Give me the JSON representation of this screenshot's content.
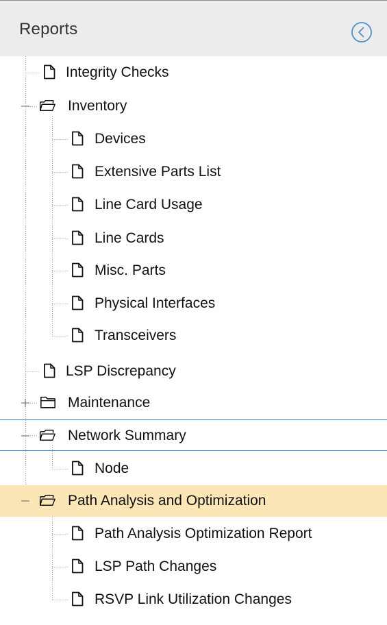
{
  "header": {
    "title": "Reports",
    "collapse_icon": "chevron-left-circle-icon"
  },
  "colors": {
    "header_bg": "#ececec",
    "selected_bg": "#fbe7b5",
    "focus_border": "#4a8fcf",
    "collapse_icon": "#4a8fcf"
  },
  "tree": {
    "nodes": [
      {
        "label": "Integrity Checks",
        "type": "report",
        "icon": "document-icon"
      },
      {
        "label": "Inventory",
        "type": "folder",
        "expanded": true,
        "icon": "open-folder-icon",
        "toggle": "minus"
      },
      {
        "label": "Devices",
        "type": "report",
        "icon": "document-icon"
      },
      {
        "label": "Extensive Parts List",
        "type": "report",
        "icon": "document-icon"
      },
      {
        "label": "Line Card Usage",
        "type": "report",
        "icon": "document-icon"
      },
      {
        "label": "Line Cards",
        "type": "report",
        "icon": "document-icon"
      },
      {
        "label": "Misc. Parts",
        "type": "report",
        "icon": "document-icon"
      },
      {
        "label": "Physical Interfaces",
        "type": "report",
        "icon": "document-icon"
      },
      {
        "label": "Transceivers",
        "type": "report",
        "icon": "document-icon"
      },
      {
        "label": "LSP Discrepancy",
        "type": "report",
        "icon": "document-icon"
      },
      {
        "label": "Maintenance",
        "type": "folder",
        "expanded": false,
        "icon": "closed-folder-icon",
        "toggle": "plus"
      },
      {
        "label": "Network Summary",
        "type": "folder",
        "expanded": true,
        "icon": "open-folder-icon",
        "toggle": "minus",
        "focused": true
      },
      {
        "label": "Node",
        "type": "report",
        "icon": "document-icon"
      },
      {
        "label": "Path Analysis and Optimization",
        "type": "folder",
        "expanded": true,
        "icon": "open-folder-icon",
        "toggle": "minus",
        "selected": true
      },
      {
        "label": "Path Analysis Optimization Report",
        "type": "report",
        "icon": "document-icon"
      },
      {
        "label": "LSP Path Changes",
        "type": "report",
        "icon": "document-icon"
      },
      {
        "label": "RSVP Link Utilization Changes",
        "type": "report",
        "icon": "document-icon"
      }
    ]
  }
}
